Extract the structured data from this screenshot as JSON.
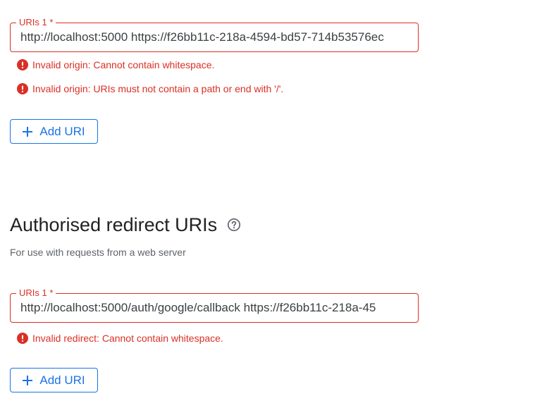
{
  "origins": {
    "field": {
      "label": "URIs 1 *",
      "value": "http://localhost:5000 https://f26bb11c-218a-4594-bd57-714b53576ec"
    },
    "errors": [
      "Invalid origin: Cannot contain whitespace.",
      "Invalid origin: URIs must not contain a path or end with '/'."
    ],
    "add_button_label": "Add URI"
  },
  "redirects": {
    "title": "Authorised redirect URIs",
    "description": "For use with requests from a web server",
    "field": {
      "label": "URIs 1 *",
      "value": "http://localhost:5000/auth/google/callback https://f26bb11c-218a-45"
    },
    "errors": [
      "Invalid redirect: Cannot contain whitespace."
    ],
    "add_button_label": "Add URI"
  },
  "icons": {
    "error": "error-circle-icon",
    "add": "plus-icon",
    "help": "help-circle-icon"
  },
  "colors": {
    "error": "#d93025",
    "accent": "#1a73e8",
    "title": "#202124",
    "secondary_text": "#5f6368"
  }
}
